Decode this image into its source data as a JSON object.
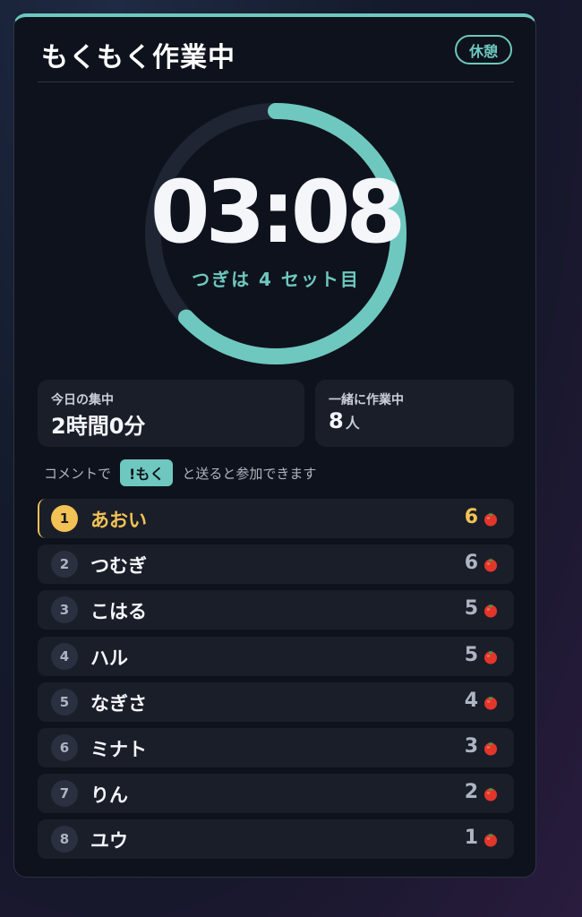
{
  "header": {
    "title": "もくもく作業中",
    "status_button": "休憩"
  },
  "timer": {
    "time": "03:08",
    "next_set": "つぎは 4 セット目",
    "progress": 0.63
  },
  "stats": {
    "today_label": "今日の集中",
    "today_value": "2時間0分",
    "together_label": "一緒に作業中",
    "together_value": "8",
    "together_unit": "人"
  },
  "comment": {
    "before": "コメントで",
    "command": "!もく",
    "after": "と送ると参加できます"
  },
  "ranking": [
    {
      "rank": "1",
      "name": "あおい",
      "count": "6"
    },
    {
      "rank": "2",
      "name": "つむぎ",
      "count": "6"
    },
    {
      "rank": "3",
      "name": "こはる",
      "count": "5"
    },
    {
      "rank": "4",
      "name": "ハル",
      "count": "5"
    },
    {
      "rank": "5",
      "name": "なぎさ",
      "count": "4"
    },
    {
      "rank": "6",
      "name": "ミナト",
      "count": "3"
    },
    {
      "rank": "7",
      "name": "りん",
      "count": "2"
    },
    {
      "rank": "8",
      "name": "ユウ",
      "count": "1"
    }
  ],
  "colors": {
    "accent": "#6ec8bf",
    "gold": "#f3c254",
    "tomato": "#e3362b"
  },
  "icons": {
    "count_icon": "tomato-icon"
  }
}
